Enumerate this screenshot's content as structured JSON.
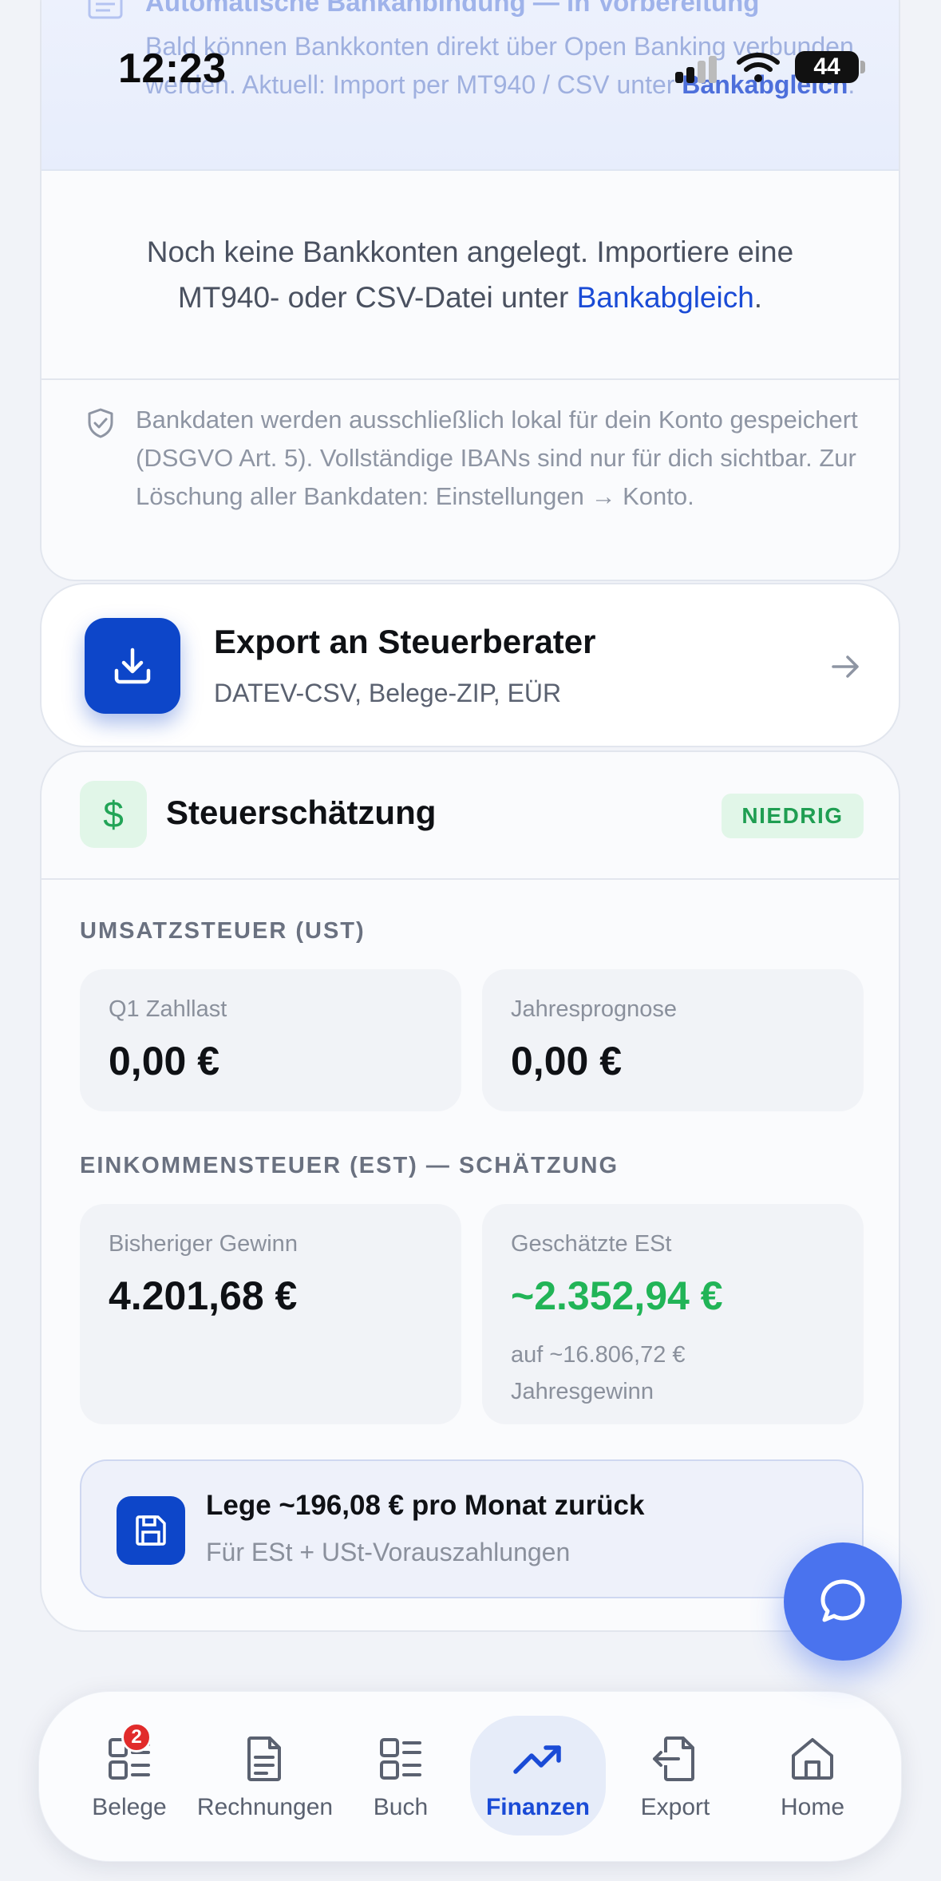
{
  "status_bar": {
    "time": "12:23",
    "battery": "44"
  },
  "bank": {
    "banner_title": "Automatische Bankanbindung — in Vorbereitung",
    "banner_text": "Bald können Bankkonten direkt über Open Banking verbunden werden. Aktuell: Import per MT940 / CSV unter ",
    "banner_link": "Bankabgleich",
    "banner_end": ".",
    "empty_text": "Noch keine Bankkonten angelegt. Importiere eine MT940- oder CSV-Datei unter ",
    "empty_link": "Bankabgleich",
    "empty_end": ".",
    "privacy_text": "Bankdaten werden ausschließlich lokal für dein Konto gespeichert (DSGVO Art. 5). Vollständige IBANs sind nur für dich sichtbar. Zur Löschung aller Bankdaten: Einstellungen → Konto."
  },
  "export": {
    "title": "Export an Steuerberater",
    "subtitle": "DATEV-CSV, Belege-ZIP, EÜR"
  },
  "tax": {
    "title": "Steuerschätzung",
    "badge": "NIEDRIG",
    "ust_label": "UMSATZSTEUER (UST)",
    "q1_label": "Q1 Zahllast",
    "q1_value": "0,00 €",
    "year_label": "Jahresprognose",
    "year_value": "0,00 €",
    "est_label": "EINKOMMENSTEUER (EST) — SCHÄTZUNG",
    "profit_label": "Bisheriger Gewinn",
    "profit_value": "4.201,68 €",
    "est_est_label": "Geschätzte ESt",
    "est_est_value": "~2.352,94 €",
    "est_note": "auf ~16.806,72 € Jahresgewinn",
    "save_title": "Lege ~196,08 € pro Monat zurück",
    "save_sub": "Für ESt + USt-Vorauszahlungen"
  },
  "nav": {
    "items": [
      {
        "label": "Belege",
        "badge": "2"
      },
      {
        "label": "Rechnungen"
      },
      {
        "label": "Buch"
      },
      {
        "label": "Finanzen"
      },
      {
        "label": "Export"
      },
      {
        "label": "Home"
      }
    ]
  },
  "colors": {
    "accent": "#1a4bd6",
    "primary_dark": "#0d46c9",
    "success": "#21b457",
    "fab": "#4a73ee",
    "badge": "#e12b2b"
  }
}
